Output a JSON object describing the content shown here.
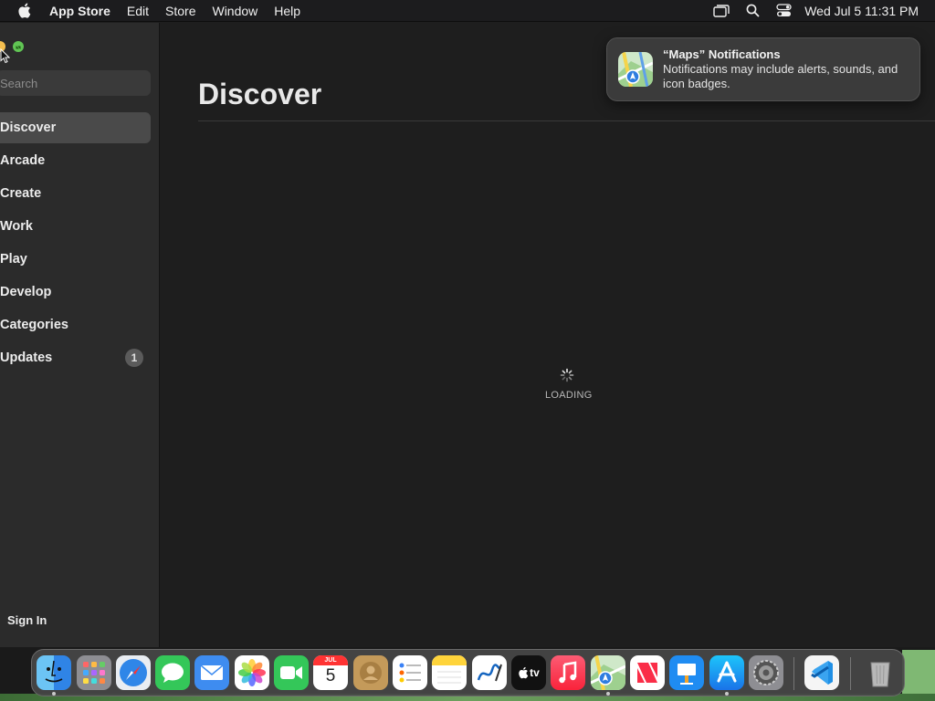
{
  "menubar": {
    "app_name": "App Store",
    "items": [
      "Edit",
      "Store",
      "Window",
      "Help"
    ],
    "clock": "Wed Jul 5  11:31 PM"
  },
  "sidebar": {
    "search_placeholder": "Search",
    "items": [
      {
        "label": "Discover",
        "active": true
      },
      {
        "label": "Arcade"
      },
      {
        "label": "Create"
      },
      {
        "label": "Work"
      },
      {
        "label": "Play"
      },
      {
        "label": "Develop"
      },
      {
        "label": "Categories"
      },
      {
        "label": "Updates",
        "badge": "1"
      }
    ],
    "sign_in": "Sign In"
  },
  "main": {
    "title": "Discover",
    "loading_text": "LOADING"
  },
  "notification": {
    "title": "“Maps” Notifications",
    "body": "Notifications may include alerts, sounds, and icon badges."
  },
  "calendar": {
    "month": "JUL",
    "day": "5"
  },
  "dock": {
    "apps": [
      "finder-icon",
      "launchpad-icon",
      "safari-icon",
      "messages-icon",
      "mail-icon",
      "photos-icon",
      "facetime-icon",
      "calendar-icon",
      "contacts-icon",
      "reminders-icon",
      "notes-icon",
      "freeform-icon",
      "tv-icon",
      "music-icon",
      "maps-icon",
      "news-icon",
      "keynote-icon",
      "app-store-icon",
      "system-settings-icon",
      "vscode-icon",
      "trash-icon"
    ],
    "tv_label": "tv"
  }
}
